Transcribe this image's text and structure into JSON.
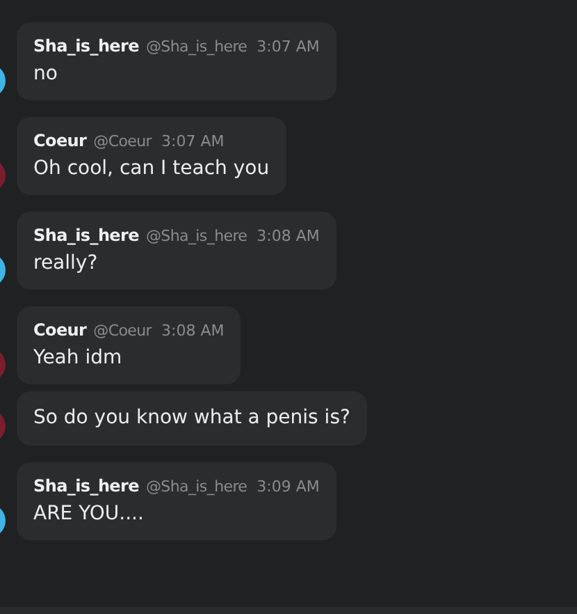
{
  "messages": [
    {
      "author": "Sha_is_here",
      "handle": "@Sha_is_here",
      "time": "3:07 AM",
      "text": "no",
      "color": "#3fb4e4"
    },
    {
      "author": "Coeur",
      "handle": "@Coeur",
      "time": "3:07 AM",
      "text": "Oh cool, can I teach you",
      "color": "#7a1d2c"
    },
    {
      "author": "Sha_is_here",
      "handle": "@Sha_is_here",
      "time": "3:08 AM",
      "text": "really?",
      "color": "#3fb4e4"
    },
    {
      "author": "Coeur",
      "handle": "@Coeur",
      "time": "3:08 AM",
      "text": "Yeah idm",
      "color": "#7a1d2c"
    },
    {
      "text": "So do you know what a penis is?",
      "color": "#7a1d2c"
    },
    {
      "author": "Sha_is_here",
      "handle": "@Sha_is_here",
      "time": "3:09 AM",
      "text": "ARE YOU....",
      "color": "#3fb4e4"
    }
  ]
}
